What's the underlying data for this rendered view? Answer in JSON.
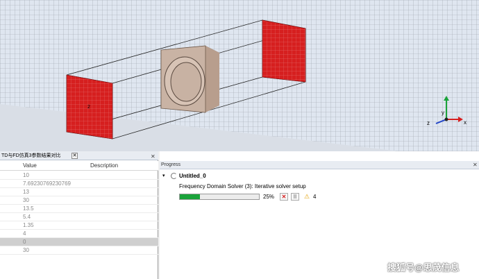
{
  "viewport": {
    "port_label": "2",
    "axes": {
      "x": "x",
      "y": "y",
      "z": "z"
    },
    "colors": {
      "port": "#d61f1f",
      "component": "#c9b3a4",
      "grid": "#9aa0a8"
    }
  },
  "params_pane": {
    "tab_title": "TD与FD仿真3参数结果对比",
    "tab_close": "✕",
    "pane_close": "✕",
    "columns": {
      "value": "Value",
      "description": "Description"
    },
    "rows": [
      {
        "value": "10"
      },
      {
        "value": "7.69230769230769"
      },
      {
        "value": "13"
      },
      {
        "value": "30"
      },
      {
        "value": "13.5"
      },
      {
        "value": "5.4"
      },
      {
        "value": "1.35"
      },
      {
        "value": "4"
      },
      {
        "value": "0"
      },
      {
        "value": "30"
      }
    ],
    "selected_row": 8
  },
  "progress": {
    "tab_title": "Progress",
    "pane_close": "✕",
    "task_name": "Untitled_0",
    "expand_icon": "▾",
    "solver_status": "Frequency Domain Solver (3): Iterative solver setup",
    "percent_value": 25,
    "percent_label": "25%",
    "stop_label": "✕",
    "pause_label": "II",
    "warning_icon": "⚠",
    "warning_count": "4",
    "colors": {
      "bar": "#1aa33a",
      "warning": "#e3a000"
    }
  },
  "watermark": "搜狐号@思茂信息"
}
